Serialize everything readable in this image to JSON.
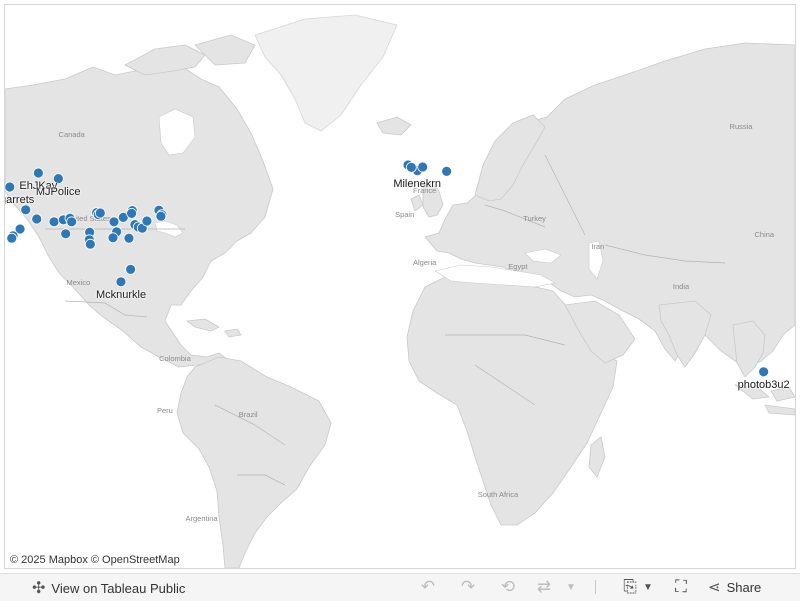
{
  "map": {
    "place_labels": [
      {
        "text": "Canada",
        "lon": -104,
        "lat": 60
      },
      {
        "text": "United States",
        "lon": -99,
        "lat": 39
      },
      {
        "text": "Mexico",
        "lon": -102,
        "lat": 23
      },
      {
        "text": "Colombia",
        "lon": -73,
        "lat": 4
      },
      {
        "text": "Peru",
        "lon": -76,
        "lat": -9
      },
      {
        "text": "Brazil",
        "lon": -51,
        "lat": -10
      },
      {
        "text": "Argentina",
        "lon": -65,
        "lat": -36
      },
      {
        "text": "Russia",
        "lon": 97,
        "lat": 62
      },
      {
        "text": "France",
        "lon": 2,
        "lat": 46
      },
      {
        "text": "Spain",
        "lon": -4,
        "lat": 40
      },
      {
        "text": "Turkey",
        "lon": 35,
        "lat": 39
      },
      {
        "text": "Algeria",
        "lon": 2,
        "lat": 28
      },
      {
        "text": "Egypt",
        "lon": 30,
        "lat": 27
      },
      {
        "text": "Iran",
        "lon": 54,
        "lat": 32
      },
      {
        "text": "India",
        "lon": 79,
        "lat": 22
      },
      {
        "text": "China",
        "lon": 104,
        "lat": 35
      },
      {
        "text": "South Africa",
        "lon": 24,
        "lat": -30
      }
    ],
    "points": [
      {
        "lon": -114,
        "lat": 51,
        "label": "EhJKay"
      },
      {
        "lon": -108,
        "lat": 49.6,
        "label": "MJPolice"
      },
      {
        "lon": -122.6,
        "lat": 47.5,
        "label": "arcgarrets"
      },
      {
        "lon": -89.2,
        "lat": 23.8,
        "label": "Mcknurkle"
      },
      {
        "lon": -0.2,
        "lat": 51.6,
        "label": "Milenekrn"
      },
      {
        "lon": 103.8,
        "lat": 1.3,
        "label": "photob3u2"
      },
      {
        "lon": -117.8,
        "lat": 41.8,
        "label": ""
      },
      {
        "lon": -119.5,
        "lat": 37.0,
        "label": ""
      },
      {
        "lon": -121.6,
        "lat": 35.3,
        "label": ""
      },
      {
        "lon": -122.0,
        "lat": 34.7,
        "label": ""
      },
      {
        "lon": -114.5,
        "lat": 39.5,
        "label": ""
      },
      {
        "lon": -109.3,
        "lat": 38.8,
        "label": ""
      },
      {
        "lon": -106.5,
        "lat": 39.3,
        "label": ""
      },
      {
        "lon": -105.8,
        "lat": 35.8,
        "label": ""
      },
      {
        "lon": -104.5,
        "lat": 39.7,
        "label": ""
      },
      {
        "lon": -104.0,
        "lat": 38.8,
        "label": ""
      },
      {
        "lon": -98.6,
        "lat": 36.2,
        "label": ""
      },
      {
        "lon": -98.7,
        "lat": 34.3,
        "label": ""
      },
      {
        "lon": -98.4,
        "lat": 33.2,
        "label": ""
      },
      {
        "lon": -96.5,
        "lat": 41.1,
        "label": ""
      },
      {
        "lon": -96.0,
        "lat": 40.6,
        "label": ""
      },
      {
        "lon": -95.4,
        "lat": 41.0,
        "label": ""
      },
      {
        "lon": -91.3,
        "lat": 38.8,
        "label": ""
      },
      {
        "lon": -90.5,
        "lat": 36.3,
        "label": ""
      },
      {
        "lon": -91.6,
        "lat": 34.8,
        "label": ""
      },
      {
        "lon": -88.5,
        "lat": 39.9,
        "label": ""
      },
      {
        "lon": -85.8,
        "lat": 41.6,
        "label": ""
      },
      {
        "lon": -86.0,
        "lat": 40.9,
        "label": ""
      },
      {
        "lon": -85.0,
        "lat": 38.1,
        "label": ""
      },
      {
        "lon": -86.8,
        "lat": 34.7,
        "label": ""
      },
      {
        "lon": -84.0,
        "lat": 37.5,
        "label": ""
      },
      {
        "lon": -82.8,
        "lat": 37.2,
        "label": ""
      },
      {
        "lon": -81.4,
        "lat": 39.0,
        "label": ""
      },
      {
        "lon": -77.8,
        "lat": 41.7,
        "label": ""
      },
      {
        "lon": -76.9,
        "lat": 40.6,
        "label": ""
      },
      {
        "lon": -77.2,
        "lat": 40.2,
        "label": ""
      },
      {
        "lon": -86.3,
        "lat": 26.9,
        "label": ""
      },
      {
        "lon": -3.0,
        "lat": 53.0,
        "label": ""
      },
      {
        "lon": -2.0,
        "lat": 52.4,
        "label": ""
      },
      {
        "lon": 1.4,
        "lat": 52.5,
        "label": ""
      },
      {
        "lon": 8.6,
        "lat": 51.4,
        "label": ""
      }
    ]
  },
  "attribution": "© 2025 Mapbox  © OpenStreetMap",
  "toolbar": {
    "view_label": "View on Tableau Public",
    "share_label": "Share"
  },
  "colors": {
    "mark": "#2f78b7",
    "land": "#e4e4e4",
    "water": "#ffffff"
  }
}
